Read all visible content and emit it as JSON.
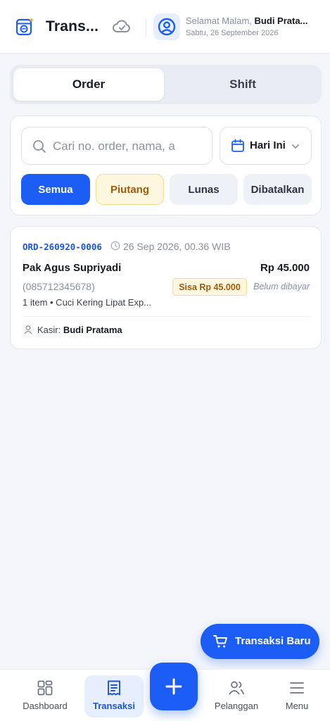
{
  "header": {
    "app_title": "Trans...",
    "greeting_prefix": "Selamat Malam, ",
    "user_name": "Budi Prata...",
    "date": "Sabtu, 26 September 2026"
  },
  "tabs": {
    "order": "Order",
    "shift": "Shift"
  },
  "filters": {
    "search_placeholder": "Cari no. order, nama, a",
    "date_range": "Hari Ini",
    "chips": [
      "Semua",
      "Piutang",
      "Lunas",
      "Dibatalkan"
    ],
    "active_chip": "Semua"
  },
  "orders": [
    {
      "id": "ORD-260920-0006",
      "time": "26 Sep 2026, 00.36 WIB",
      "customer": "Pak Agus Supriyadi",
      "total": "Rp 45.000",
      "phone": "(085712345678)",
      "remaining": "Sisa Rp 45.000",
      "payment_status": "Belum dibayar",
      "items": "1 item • Cuci Kering Lipat Exp...",
      "cashier_label": "Kasir: ",
      "cashier": "Budi Pratama"
    }
  ],
  "fab": {
    "label": "Transaksi Baru"
  },
  "nav": {
    "dashboard": "Dashboard",
    "transaksi": "Transaksi",
    "pelanggan": "Pelanggan",
    "menu": "Menu",
    "active": "Transaksi"
  },
  "colors": {
    "primary": "#1c5ef5",
    "warning_bg": "#fef7e0",
    "warning_text": "#a15a0b",
    "id_blue": "#1c55d8"
  },
  "icons": [
    "washing-machine-icon",
    "cloud-sync-icon",
    "user-circle-icon",
    "search-icon",
    "calendar-icon",
    "chevron-down-icon",
    "clock-icon",
    "user-icon",
    "cart-icon",
    "dashboard-icon",
    "receipt-icon",
    "plus-icon",
    "users-icon",
    "menu-icon"
  ]
}
